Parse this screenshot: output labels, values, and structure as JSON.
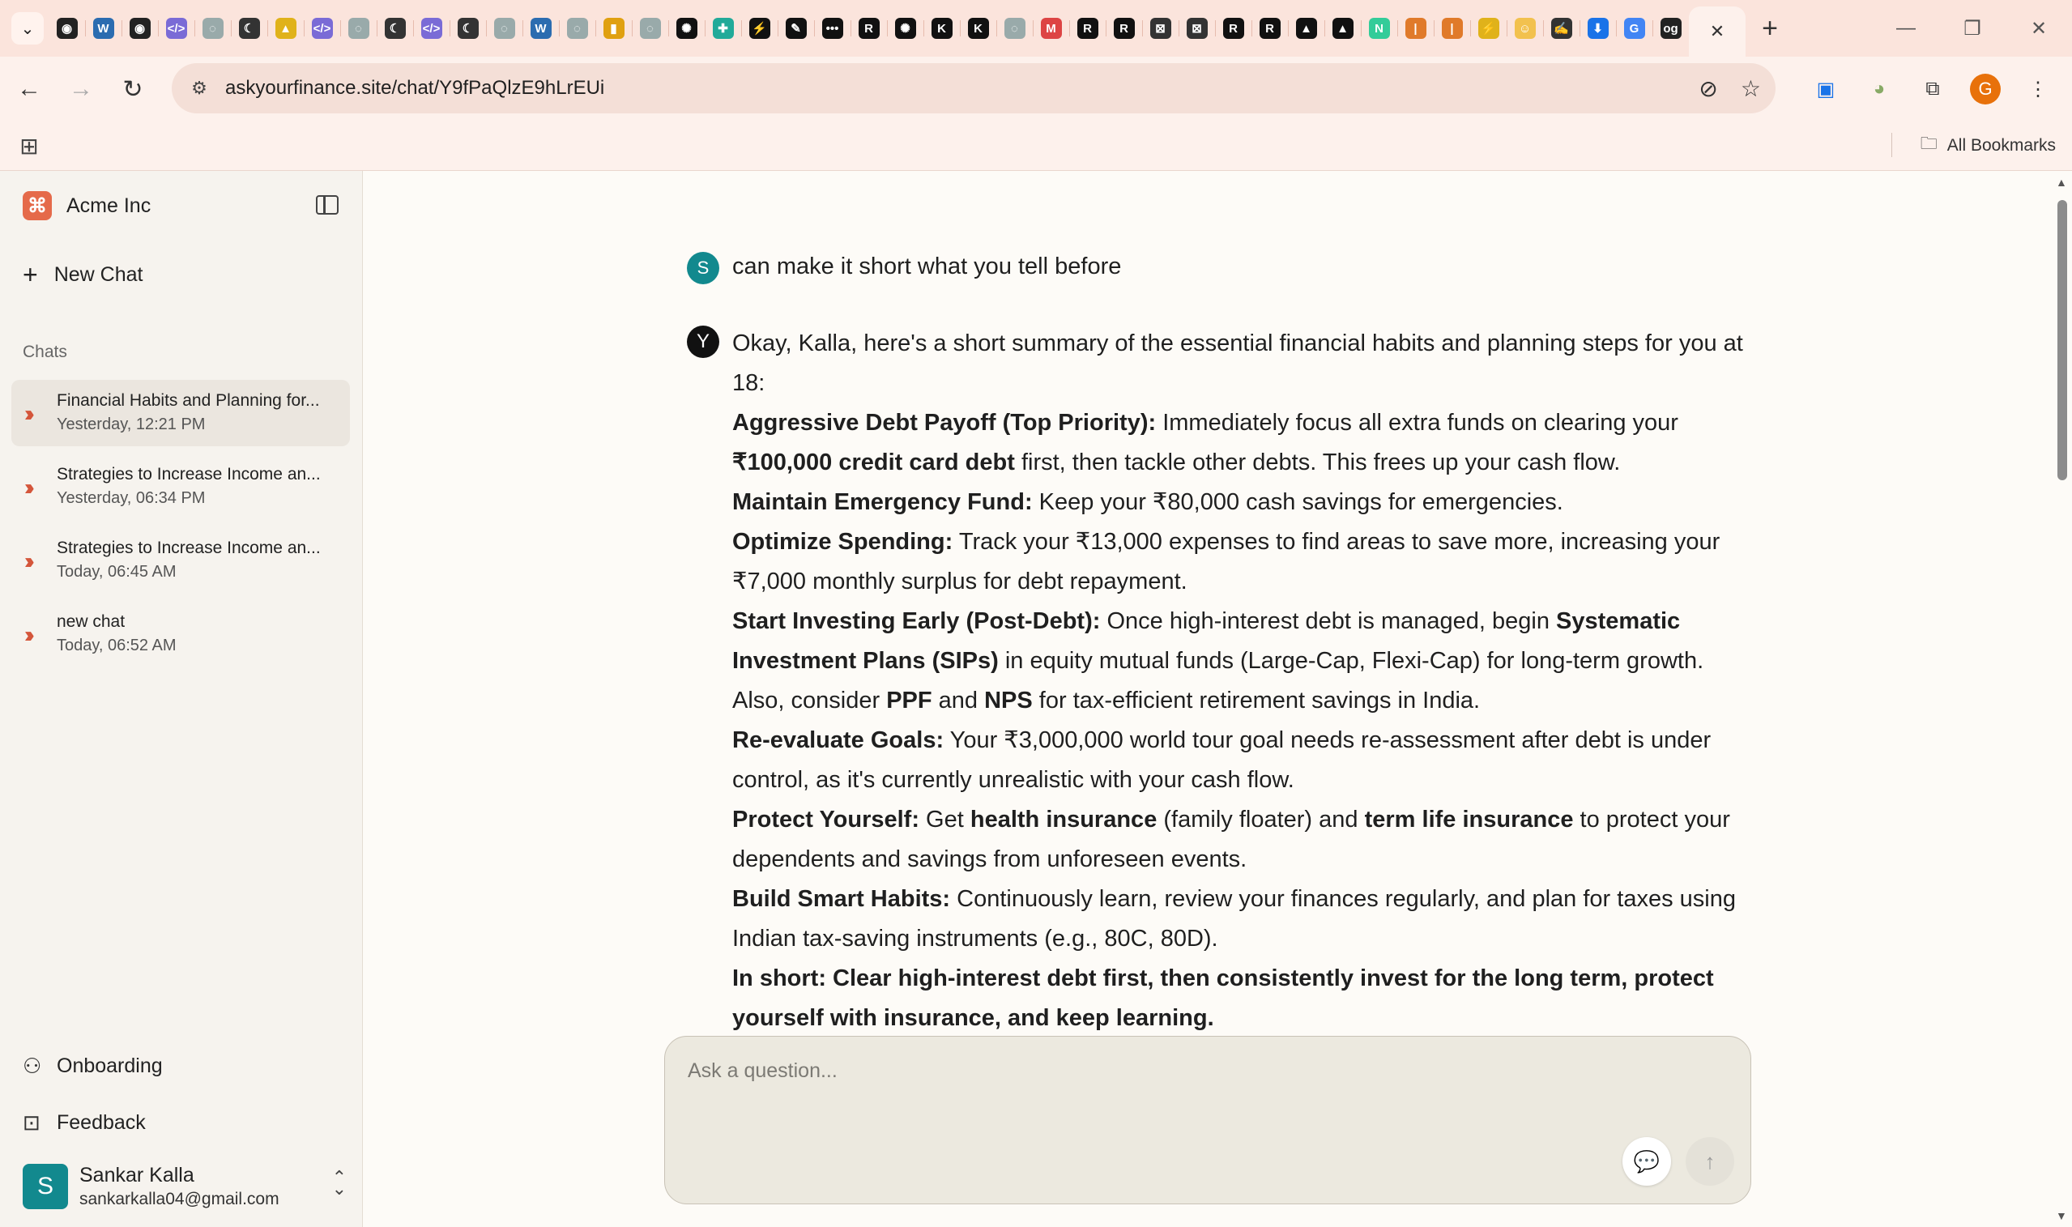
{
  "browser": {
    "url": "askyourfinance.site/chat/Y9fPaQlzE9hLrEUi",
    "all_bookmarks": "All Bookmarks",
    "profile_initial": "G",
    "tab_icons": [
      {
        "glyph": "◉",
        "bg": "#222"
      },
      {
        "glyph": "W",
        "bg": "#2b6cb0"
      },
      {
        "glyph": "◉",
        "bg": "#222"
      },
      {
        "glyph": "</>",
        "bg": "#7a6bd6"
      },
      {
        "glyph": "◌",
        "bg": "#9aa"
      },
      {
        "glyph": "☾",
        "bg": "#333"
      },
      {
        "glyph": "▲",
        "bg": "#e0b21a"
      },
      {
        "glyph": "</>",
        "bg": "#7a6bd6"
      },
      {
        "glyph": "◌",
        "bg": "#9aa"
      },
      {
        "glyph": "☾",
        "bg": "#333"
      },
      {
        "glyph": "</>",
        "bg": "#7a6bd6"
      },
      {
        "glyph": "☾",
        "bg": "#333"
      },
      {
        "glyph": "◌",
        "bg": "#9aa"
      },
      {
        "glyph": "W",
        "bg": "#2b6cb0"
      },
      {
        "glyph": "◌",
        "bg": "#9aa"
      },
      {
        "glyph": "▮",
        "bg": "#e0a010"
      },
      {
        "glyph": "◌",
        "bg": "#9aa"
      },
      {
        "glyph": "✺",
        "bg": "#111"
      },
      {
        "glyph": "✚",
        "bg": "#2a9"
      },
      {
        "glyph": "⚡",
        "bg": "#111"
      },
      {
        "glyph": "✎",
        "bg": "#111"
      },
      {
        "glyph": "•••",
        "bg": "#111"
      },
      {
        "glyph": "R",
        "bg": "#111"
      },
      {
        "glyph": "✺",
        "bg": "#111"
      },
      {
        "glyph": "K",
        "bg": "#111"
      },
      {
        "glyph": "K",
        "bg": "#111"
      },
      {
        "glyph": "◌",
        "bg": "#9aa"
      },
      {
        "glyph": "M",
        "bg": "#d44"
      },
      {
        "glyph": "R",
        "bg": "#111"
      },
      {
        "glyph": "R",
        "bg": "#111"
      },
      {
        "glyph": "⊠",
        "bg": "#333"
      },
      {
        "glyph": "⊠",
        "bg": "#333"
      },
      {
        "glyph": "R",
        "bg": "#111"
      },
      {
        "glyph": "R",
        "bg": "#111"
      },
      {
        "glyph": "▲",
        "bg": "#111"
      },
      {
        "glyph": "▲",
        "bg": "#111"
      },
      {
        "glyph": "N",
        "bg": "#3c9"
      },
      {
        "glyph": "|",
        "bg": "#e07a2a"
      },
      {
        "glyph": "|",
        "bg": "#e07a2a"
      },
      {
        "glyph": "⚡",
        "bg": "#e0b21a"
      },
      {
        "glyph": "☺",
        "bg": "#f2c14e"
      },
      {
        "glyph": "✍",
        "bg": "#333"
      },
      {
        "glyph": "⬇",
        "bg": "#1a73e8"
      },
      {
        "glyph": "G",
        "bg": "#4285f4"
      },
      {
        "glyph": "og",
        "bg": "#222"
      }
    ]
  },
  "sidebar": {
    "brand": "Acme Inc",
    "new_chat": "New Chat",
    "chats_label": "Chats",
    "chats": [
      {
        "title": "Financial Habits and Planning for...",
        "time": "Yesterday, 12:21 PM",
        "active": true
      },
      {
        "title": "Strategies to Increase Income an...",
        "time": "Yesterday, 06:34 PM",
        "active": false
      },
      {
        "title": "Strategies to Increase Income an...",
        "time": "Today, 06:45 AM",
        "active": false
      },
      {
        "title": "new chat",
        "time": "Today, 06:52 AM",
        "active": false
      }
    ],
    "onboarding": "Onboarding",
    "feedback": "Feedback",
    "user": {
      "initial": "S",
      "name": "Sankar Kalla",
      "email": "sankarkalla04@gmail.com"
    }
  },
  "conversation": {
    "user_initial": "S",
    "user_message": "can make it short what you tell before",
    "intro": "Okay, Kalla, here's a short summary of the essential financial habits and planning steps for you at 18:",
    "points": [
      {
        "head": "Aggressive Debt Payoff (Top Priority):",
        "parts": [
          [
            "Immediately focus all extra funds on clearing your ",
            false
          ],
          [
            "₹100,000 credit card debt",
            true
          ],
          [
            " first, then tackle other debts. This frees up your cash flow.",
            false
          ]
        ]
      },
      {
        "head": "Maintain Emergency Fund:",
        "parts": [
          [
            "Keep your ₹80,000 cash savings for emergencies.",
            false
          ]
        ]
      },
      {
        "head": "Optimize Spending:",
        "parts": [
          [
            "Track your ₹13,000 expenses to find areas to save more, increasing your ₹7,000 monthly surplus for debt repayment.",
            false
          ]
        ]
      },
      {
        "head": "Start Investing Early (Post-Debt):",
        "parts": [
          [
            "Once high-interest debt is managed, begin ",
            false
          ],
          [
            "Systematic Investment Plans (SIPs)",
            true
          ],
          [
            " in equity mutual funds (Large-Cap, Flexi-Cap) for long-term growth. Also, consider ",
            false
          ],
          [
            "PPF",
            true
          ],
          [
            " and ",
            false
          ],
          [
            "NPS",
            true
          ],
          [
            " for tax-efficient retirement savings in India.",
            false
          ]
        ]
      },
      {
        "head": "Re-evaluate Goals:",
        "parts": [
          [
            "Your ₹3,000,000 world tour goal needs re-assessment after debt is under control, as it's currently unrealistic with your cash flow.",
            false
          ]
        ]
      },
      {
        "head": "Protect Yourself:",
        "parts": [
          [
            "Get ",
            false
          ],
          [
            "health insurance",
            true
          ],
          [
            " (family floater) and ",
            false
          ],
          [
            "term life insurance",
            true
          ],
          [
            " to protect your dependents and savings from unforeseen events.",
            false
          ]
        ]
      },
      {
        "head": "Build Smart Habits:",
        "parts": [
          [
            "Continuously learn, review your finances regularly, and plan for taxes using Indian tax-saving instruments (e.g., 80C, 80D).",
            false
          ]
        ]
      }
    ],
    "summary": "In short: Clear high-interest debt first, then consistently invest for the long term, protect yourself with insurance, and keep learning."
  },
  "composer": {
    "placeholder": "Ask a question..."
  }
}
